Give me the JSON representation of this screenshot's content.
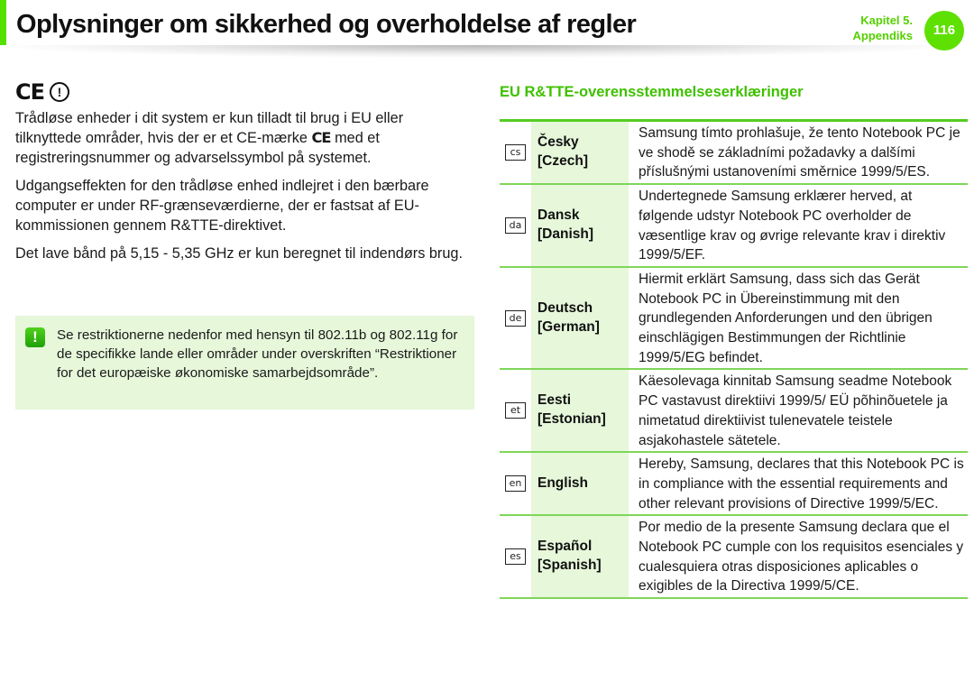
{
  "header": {
    "title": "Oplysninger om sikkerhed og overholdelse af regler",
    "chapter_line1": "Kapitel 5.",
    "chapter_line2": "Appendiks",
    "page_number": "116",
    "accent_color": "#55e000"
  },
  "left": {
    "ce_symbol": "CE",
    "alert_symbol": "!",
    "paragraph1_part1": "Trådløse enheder i dit system er kun tilladt til brug i EU eller tilknyttede områder, hvis der er et CE-mærke ",
    "paragraph1_ce": "CE",
    "paragraph1_part2": " med et registreringsnummer og advarselssymbol på systemet.",
    "paragraph2": "Udgangseffekten for den trådløse enhed indlejret i den bærbare computer er under RF-grænseværdierne, der er fastsat af EU-kommissionen gennem R&TTE-direktivet.",
    "paragraph3": "Det lave bånd på 5,15 - 5,35 GHz er kun beregnet til indendørs brug.",
    "note": {
      "icon": "!",
      "text": "Se restriktionerne nedenfor med hensyn til 802.11b og 802.11g for de specifikke lande eller områder under overskriften “Restriktioner for det europæiske økonomiske samarbejdsområde”."
    }
  },
  "right": {
    "section_title": "EU R&TTE-overensstemmelseserklæringer",
    "rows": [
      {
        "code": "cs",
        "name": "Česky",
        "english": "[Czech]",
        "text": "Samsung tímto prohlašuje, že tento Notebook PC je ve shodě se základními požadavky a dalšími příslušnými ustanoveními směrnice 1999/5/ES."
      },
      {
        "code": "da",
        "name": "Dansk",
        "english": "[Danish]",
        "text": "Undertegnede Samsung erklærer herved, at følgende udstyr Notebook PC overholder de væsentlige krav og øvrige relevante krav i direktiv 1999/5/EF."
      },
      {
        "code": "de",
        "name": "Deutsch",
        "english": "[German]",
        "text": "Hiermit erklärt Samsung, dass sich das Gerät Notebook PC in Übereinstimmung mit den grundlegenden Anforderungen und den übrigen einschlägigen Bestimmungen der Richtlinie 1999/5/EG befindet."
      },
      {
        "code": "et",
        "name": "Eesti",
        "english": "[Estonian]",
        "text": "Käesolevaga kinnitab Samsung seadme Notebook PC vastavust direktiivi 1999/5/ EÜ põhinõuetele ja nimetatud direktiivist tulenevatele teistele asjakohastele sätetele."
      },
      {
        "code": "en",
        "name": "English",
        "english": "",
        "text": "Hereby, Samsung, declares that this Notebook PC is in compliance with the essential requirements and other relevant provisions of Directive 1999/5/EC."
      },
      {
        "code": "es",
        "name": "Español",
        "english": "[Spanish]",
        "text": "Por medio de la presente Samsung declara que el Notebook PC cumple con los requisitos esenciales y cualesquiera otras disposiciones aplicables o exigibles de la Directiva 1999/5/CE."
      }
    ]
  }
}
